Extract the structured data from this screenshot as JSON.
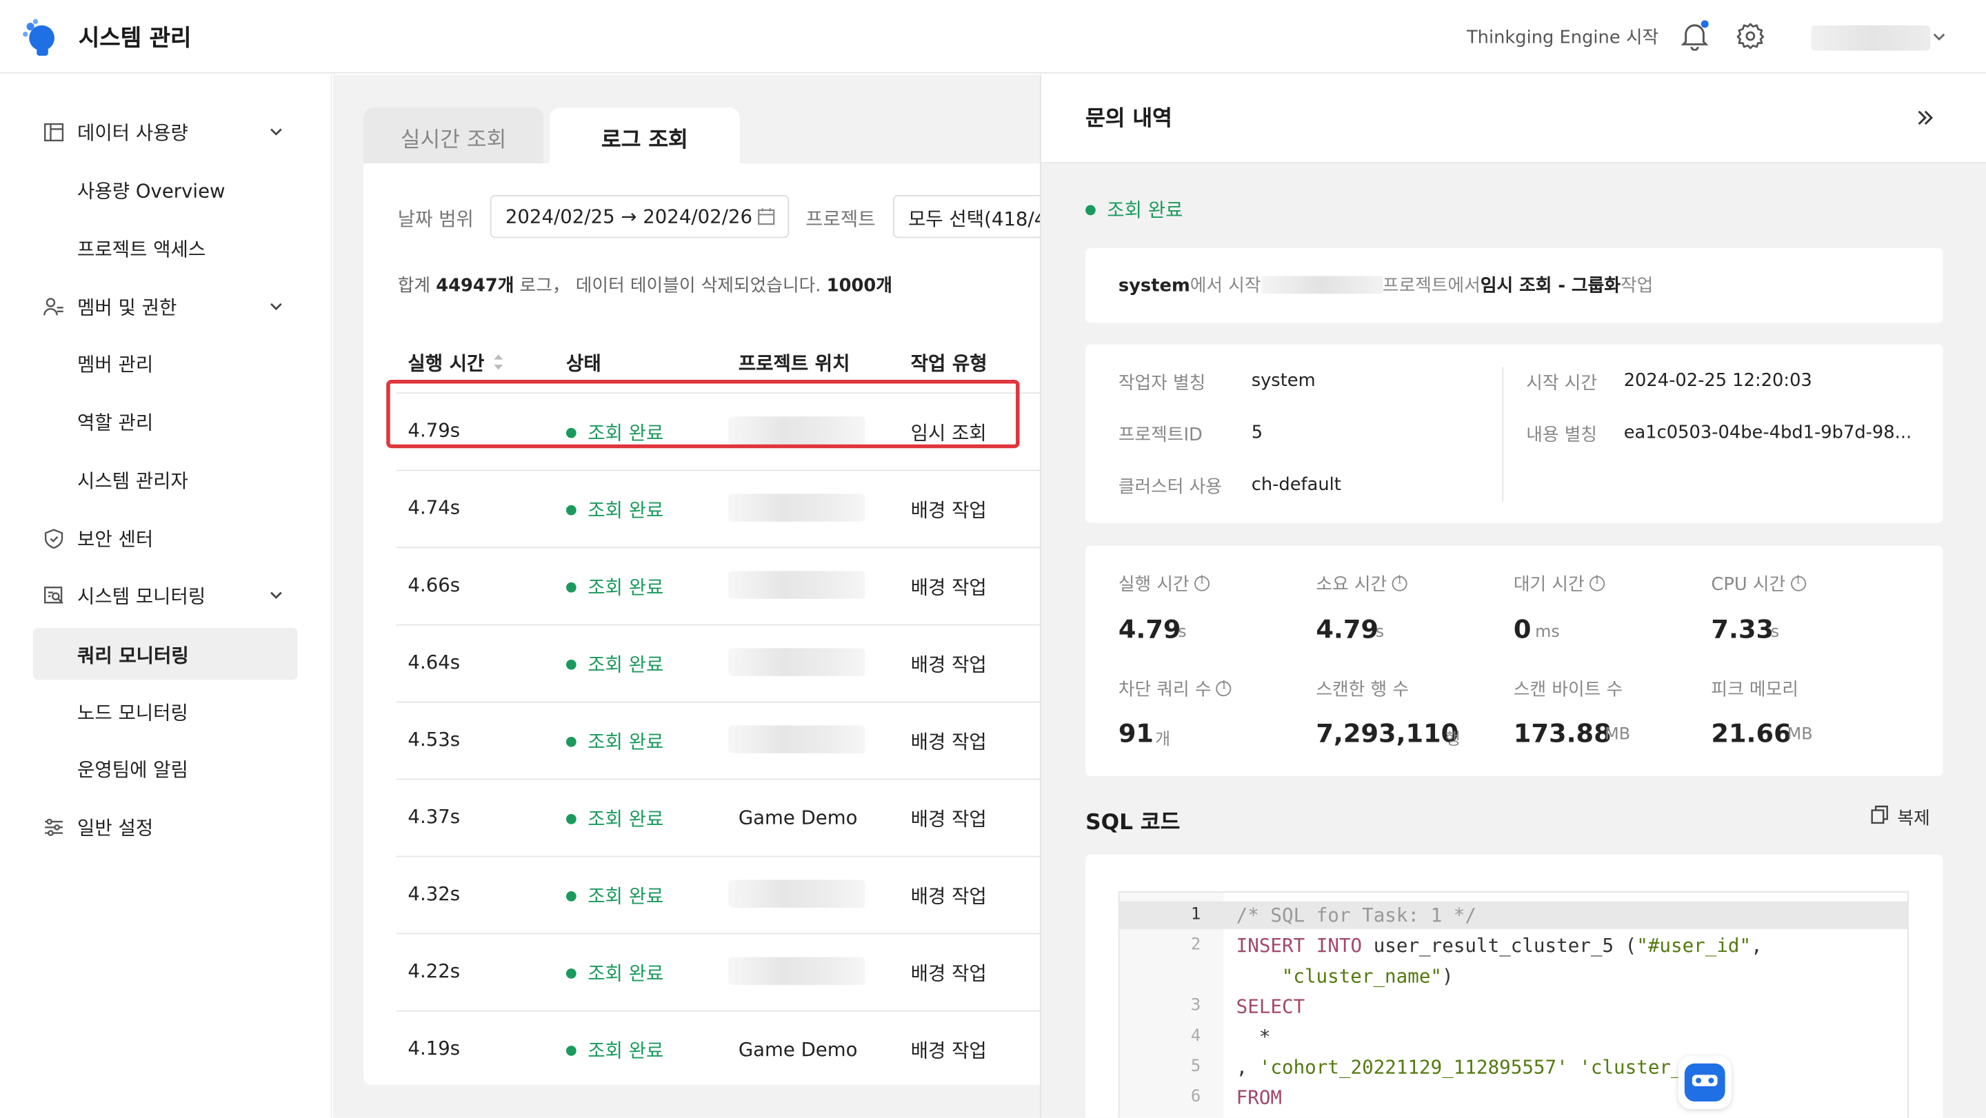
{
  "header": {
    "app_title": "시스템 관리",
    "engine_link": "Thinkging Engine 시작"
  },
  "sidebar": {
    "items": [
      {
        "label": "데이터 사용량",
        "icon": "data-usage-icon"
      },
      {
        "label": "사용량 Overview"
      },
      {
        "label": "프로젝트 액세스"
      },
      {
        "label": "멤버 및 권한",
        "icon": "members-icon"
      },
      {
        "label": "멤버 관리"
      },
      {
        "label": "역할 관리"
      },
      {
        "label": "시스템 관리자"
      },
      {
        "label": "보안 센터",
        "icon": "shield-icon"
      },
      {
        "label": "시스템 모니터링",
        "icon": "monitor-icon"
      },
      {
        "label": "쿼리 모니터링",
        "active": true
      },
      {
        "label": "노드 모니터링"
      },
      {
        "label": "운영팀에 알림"
      },
      {
        "label": "일반 설정",
        "icon": "settings-sliders-icon"
      }
    ]
  },
  "main": {
    "tabs": [
      {
        "label": "실시간 조회",
        "active": false
      },
      {
        "label": "로그 조회",
        "active": true
      }
    ],
    "filters": {
      "date_label": "날짜 범위",
      "date_value": "2024/02/25 → 2024/02/26",
      "project_label": "프로젝트",
      "project_value": "모두 선택(418/4"
    },
    "summary": {
      "prefix": "합계",
      "count": "44947개",
      "middle": "로그， 데이터 테이블이 삭제되었습니다.",
      "tail": "1000개"
    },
    "table": {
      "columns": [
        "실행 시간",
        "상태",
        "프로젝트 위치",
        "작업 유형"
      ],
      "rows": [
        {
          "time": "4.79s",
          "status": "조회 완료",
          "project": "",
          "type": "임시 조회"
        },
        {
          "time": "4.74s",
          "status": "조회 완료",
          "project": "",
          "type": "배경 작업"
        },
        {
          "time": "4.66s",
          "status": "조회 완료",
          "project": "",
          "type": "배경 작업"
        },
        {
          "time": "4.64s",
          "status": "조회 완료",
          "project": "",
          "type": "배경 작업"
        },
        {
          "time": "4.53s",
          "status": "조회 완료",
          "project": "",
          "type": "배경 작업"
        },
        {
          "time": "4.37s",
          "status": "조회 완료",
          "project": "Game Demo",
          "type": "배경 작업"
        },
        {
          "time": "4.32s",
          "status": "조회 완료",
          "project": "",
          "type": "배경 작업"
        },
        {
          "time": "4.22s",
          "status": "조회 완료",
          "project": "",
          "type": "배경 작업"
        },
        {
          "time": "4.19s",
          "status": "조회 완료",
          "project": "Game Demo",
          "type": "배경 작업"
        }
      ]
    }
  },
  "detail": {
    "title": "문의 내역",
    "status": "조회 완료",
    "description": {
      "user": "system",
      "from_text": "에서 시작",
      "project_text": "프로젝트에서",
      "task_name": "임시 조회 - 그룹화",
      "task_suffix": "작업"
    },
    "info": {
      "operator_alias_label": "작업자 별칭",
      "operator_alias": "system",
      "project_id_label": "프로젝트ID",
      "project_id": "5",
      "cluster_label": "클러스터 사용",
      "cluster": "ch-default",
      "start_time_label": "시작 시간",
      "start_time": "2024-02-25 12:20:03",
      "content_alias_label": "내용 별칭",
      "content_alias": "ea1c0503-04be-4bd1-9b7d-98..."
    },
    "metrics": [
      {
        "label": "실행 시간",
        "value": "4.79",
        "unit": "s",
        "info": true
      },
      {
        "label": "소요 시간",
        "value": "4.79",
        "unit": "s",
        "info": true
      },
      {
        "label": "대기 시간",
        "value": "0",
        "unit": "ms",
        "info": true
      },
      {
        "label": "CPU 시간",
        "value": "7.33",
        "unit": "s",
        "info": true
      },
      {
        "label": "차단 쿼리 수",
        "value": "91",
        "unit": "개",
        "info": true
      },
      {
        "label": "스캔한 행 수",
        "value": "7,293,110",
        "unit": "행",
        "info": false
      },
      {
        "label": "스캔 바이트 수",
        "value": "173.88",
        "unit": "MB",
        "info": false
      },
      {
        "label": "피크 메모리",
        "value": "21.66",
        "unit": "MB",
        "info": false
      }
    ],
    "sql": {
      "title": "SQL 코드",
      "copy_label": "복제",
      "line_numbers": [
        "1",
        "2",
        "3",
        "4",
        "5",
        "6"
      ],
      "line1": "/* SQL for Task: 1 */",
      "line2_kw": "INSERT INTO",
      "line2_rest": " user_result_cluster_5 (",
      "line2_str": "\"#user_id\"",
      "line2_end": ",",
      "line2b_str": "\"cluster_name\"",
      "line2b_end": ")",
      "line3": "SELECT",
      "line4": "  *",
      "line5_pre": ", ",
      "line5_str": "'cohort_20221129_112895557'",
      "line5_str2": " 'cluster_",
      "line5_end": "'",
      "line6": "FROM"
    }
  },
  "colors": {
    "accent_green": "#1a9a5c",
    "highlight_red": "#e0353d",
    "logo_blue": "#1f6fe5"
  }
}
